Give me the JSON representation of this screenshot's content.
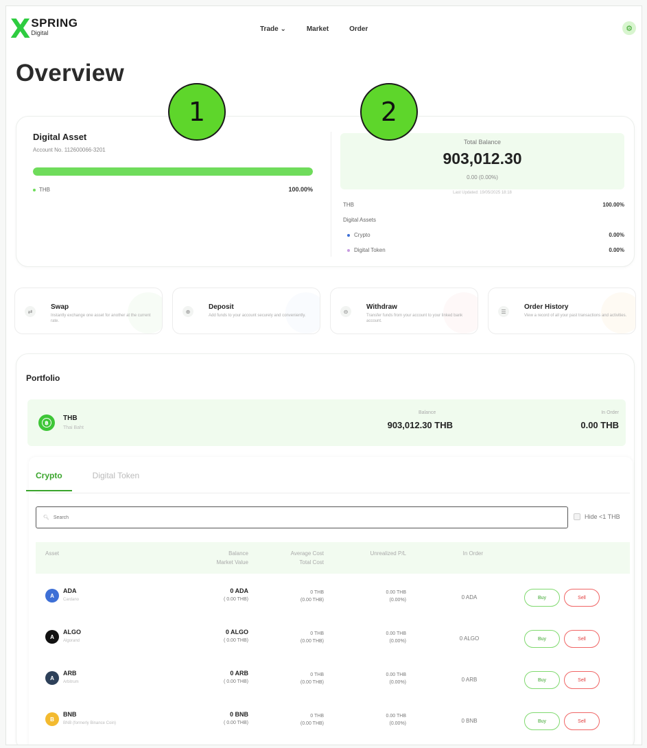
{
  "brand": {
    "mark": "X",
    "name": "SPRING",
    "sub": "Digital",
    "accent": "#2ecc40"
  },
  "nav": {
    "trade": "Trade ⌄",
    "market": "Market",
    "order": "Order"
  },
  "header": {
    "settings_icon": "gear-icon"
  },
  "page_title": "Overview",
  "markers": {
    "one": "1",
    "two": "2"
  },
  "digital_asset": {
    "title": "Digital Asset",
    "account": "Account No. 112600066-3201",
    "allocation_fraction": 1.0,
    "legend_label": "THB",
    "legend_pct": "100.00%"
  },
  "balance": {
    "label": "Total Balance",
    "value": "903,012.30",
    "change": "0.00 (0.00%)",
    "updated": "Last Updated: 19/05/2025 18:18",
    "rows": {
      "thb_label": "THB",
      "thb_pct": "100.00%",
      "digital_assets_label": "Digital Assets",
      "crypto_label": "Crypto",
      "crypto_pct": "0.00%",
      "token_label": "Digital Token",
      "token_pct": "0.00%"
    }
  },
  "actions": [
    {
      "title": "Swap",
      "desc": "Instantly exchange one asset for another at the current rate.",
      "icon": "swap-icon"
    },
    {
      "title": "Deposit",
      "desc": "Add funds to your account securely and conveniently.",
      "icon": "deposit-icon"
    },
    {
      "title": "Withdraw",
      "desc": "Transfer funds from your account to your linked bank account.",
      "icon": "withdraw-icon"
    },
    {
      "title": "Order History",
      "desc": "View a record of all your past transactions and activities.",
      "icon": "history-icon"
    }
  ],
  "portfolio": {
    "title": "Portfolio",
    "thb": {
      "code": "THB",
      "name": "Thai Baht",
      "balance_label": "Balance",
      "balance": "903,012.30 THB",
      "in_order_label": "In Order",
      "in_order": "0.00 THB"
    },
    "tabs": [
      "Crypto",
      "Digital Token"
    ],
    "search_placeholder": "Search",
    "hide_small": "Hide <1 THB",
    "columns": {
      "asset": "Asset",
      "balance": "Balance",
      "market_value": "Market Value",
      "avg_cost": "Average Cost",
      "total_cost": "Total Cost",
      "pnl": "Unrealized P/L",
      "in_order": "In Order"
    },
    "rows": [
      {
        "code": "ADA",
        "name": "Cardano",
        "balance": "0 ADA",
        "market_value": "( 0.00 THB)",
        "avg_cost": "0 THB",
        "total_cost": "(0.00 THB)",
        "pnl": "0.00 THB",
        "pnl_pct": "(0.00%)",
        "in_order": "0 ADA",
        "buy": "Buy",
        "sell": "Sell",
        "color": "#3d6fd6"
      },
      {
        "code": "ALGO",
        "name": "Algorand",
        "balance": "0 ALGO",
        "market_value": "( 0.00 THB)",
        "avg_cost": "0 THB",
        "total_cost": "(0.00 THB)",
        "pnl": "0.00 THB",
        "pnl_pct": "(0.00%)",
        "in_order": "0 ALGO",
        "buy": "Buy",
        "sell": "Sell",
        "color": "#111111"
      },
      {
        "code": "ARB",
        "name": "Arbitrum",
        "balance": "0 ARB",
        "market_value": "( 0.00 THB)",
        "avg_cost": "0 THB",
        "total_cost": "(0.00 THB)",
        "pnl": "0.00 THB",
        "pnl_pct": "(0.00%)",
        "in_order": "0 ARB",
        "buy": "Buy",
        "sell": "Sell",
        "color": "#2d4059"
      },
      {
        "code": "BNB",
        "name": "BNB (formerly Binance Coin)",
        "balance": "0 BNB",
        "market_value": "( 0.00 THB)",
        "avg_cost": "0 THB",
        "total_cost": "(0.00 THB)",
        "pnl": "0.00 THB",
        "pnl_pct": "(0.00%)",
        "in_order": "0 BNB",
        "buy": "Buy",
        "sell": "Sell",
        "color": "#f3ba2f"
      }
    ]
  },
  "colors": {
    "green": "#3aa52c",
    "bar": "#6fdc5b",
    "sell": "#e23a3a",
    "crypto_dot": "#3d6fd6",
    "token_dot": "#c79be0"
  }
}
